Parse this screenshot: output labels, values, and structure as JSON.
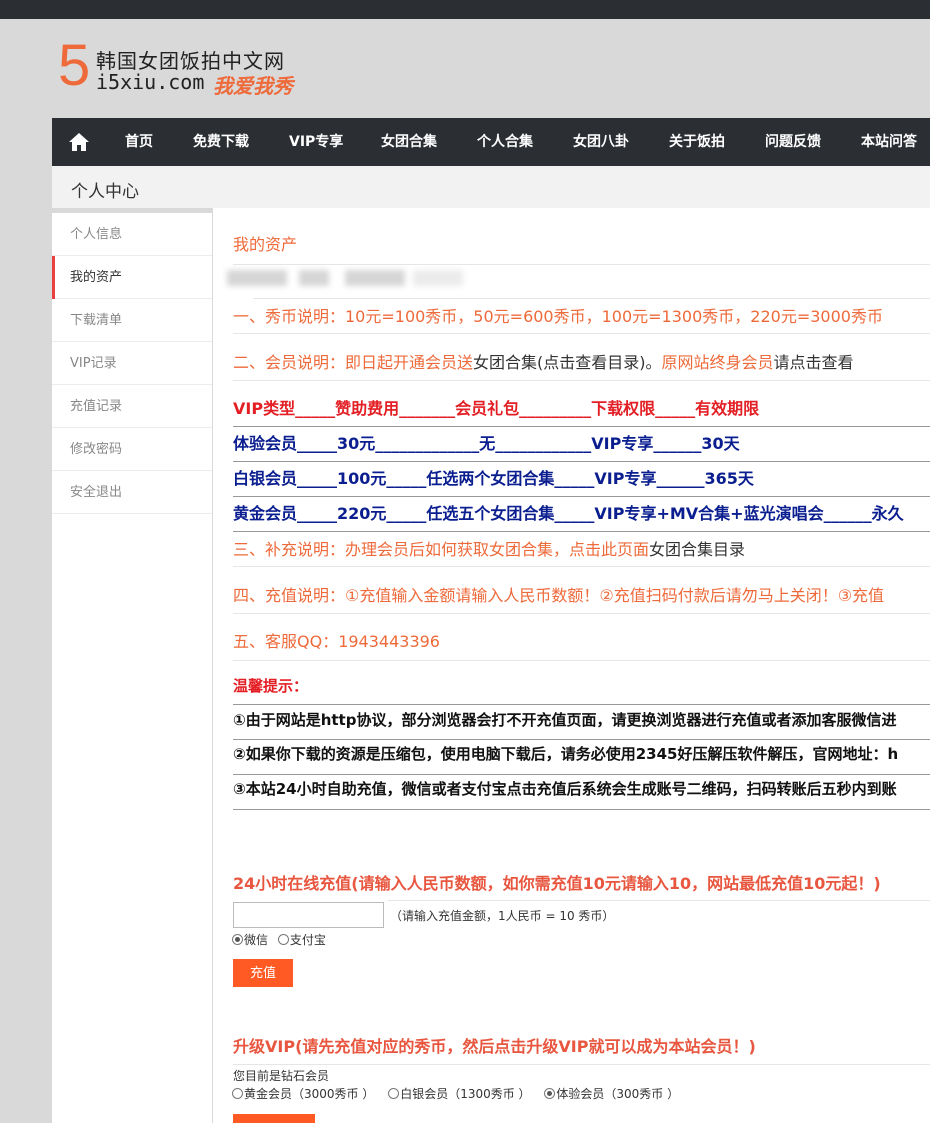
{
  "logo": {
    "digit": "5",
    "line1": "韩国女团饭拍中文网",
    "line2": "i5xiu.com",
    "slogan": "我爱我秀"
  },
  "nav": {
    "items": [
      "首页",
      "免费下载",
      "VIP专享",
      "女团合集",
      "个人合集",
      "女团八卦",
      "关于饭拍",
      "问题反馈",
      "本站问答"
    ]
  },
  "page_header": {
    "title": "个人中心"
  },
  "sidebar": {
    "items": [
      "个人信息",
      "我的资产",
      "下载清单",
      "VIP记录",
      "充值记录",
      "修改密码",
      "安全退出"
    ],
    "active_index": 1
  },
  "assets": {
    "title": "我的资产",
    "line1": "一、秀币说明：10元=100秀币，50元=600秀币，100元=1300秀币，220元=3000秀币",
    "line2_a": "二、会员说明：即日起开通会员送",
    "line2_b": "女团合集(点击查看目录)。",
    "line2_c": "原网站终身会员",
    "line2_d": "请点击查看",
    "vip_header": "VIP类型_____赞助费用_______会员礼包_________下载权限_____有效期限",
    "vip_rows": [
      "体验会员_____30元_____________无____________VIP专享______30天",
      "白银会员_____100元_____任选两个女团合集_____VIP专享______365天",
      "黄金会员_____220元_____任选五个女团合集_____VIP专享+MV合集+蓝光演唱会______永久"
    ],
    "line3_a": "三、补充说明：办理会员后如何获取女团合集，点击此页面",
    "line3_b": "女团合集目录",
    "line4": "四、充值说明：①充值输入金额请输入人民币数额！②充值扫码付款后请勿马上关闭！③充值",
    "line5": "五、客服QQ：1943443396",
    "warm_title": "温馨提示：",
    "tips": [
      "①由于网站是http协议，部分浏览器会打不开充值页面，请更换浏览器进行充值或者添加客服微信进",
      "②如果你下载的资源是压缩包，使用电脑下载后，请务必使用2345好压解压软件解压，官网地址：h",
      "③本站24小时自助充值，微信或者支付宝点击充值后系统会生成账号二维码，扫码转账后五秒内到账"
    ]
  },
  "recharge": {
    "title": "24小时在线充值(请输入人民币数额，如你需充值10元请输入10，网站最低充值10元起！)",
    "input_value": "",
    "hint": "（请输入充值金额，1人民币 = 10 秀币）",
    "options": [
      "微信",
      "支付宝"
    ],
    "selected": 0,
    "button": "充值"
  },
  "upgrade": {
    "title": "升级VIP(请先充值对应的秀币，然后点击升级VIP就可以成为本站会员！)",
    "status": "您目前是钻石会员",
    "options": [
      "黄金会员（3000秀币 ）",
      "白银会员（1300秀币 ）",
      "体验会员（300秀币 ）"
    ],
    "selected": 2
  }
}
